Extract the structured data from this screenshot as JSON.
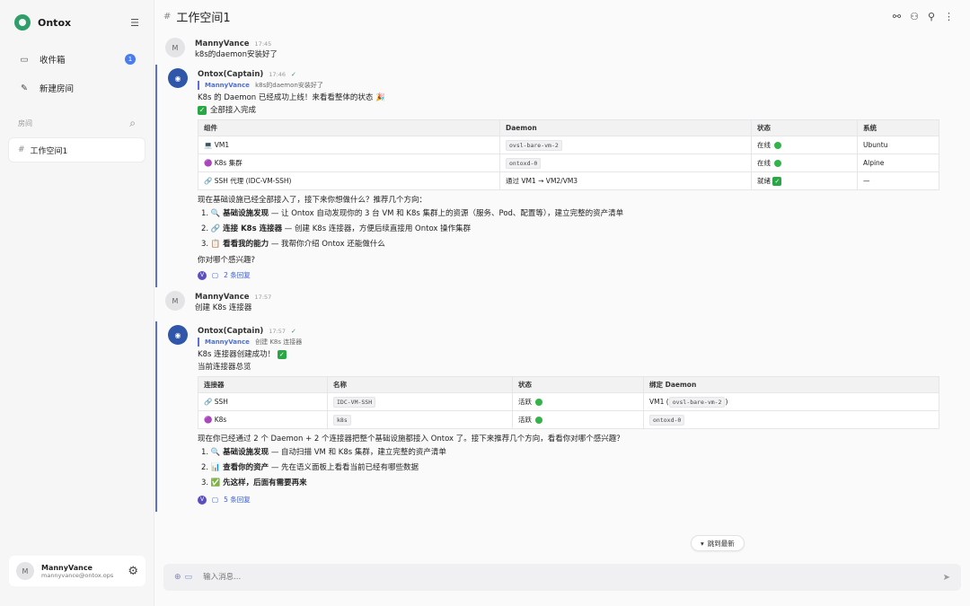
{
  "app": {
    "name": "Ontox"
  },
  "sidebar": {
    "nav": [
      {
        "label": "收件箱",
        "badge": "1"
      },
      {
        "label": "新建房间"
      }
    ],
    "section_label": "房间",
    "rooms": [
      {
        "label": "工作空间1"
      }
    ],
    "user": {
      "initial": "M",
      "name": "MannyVance",
      "email": "mannyvance@ontox.ops..."
    }
  },
  "header": {
    "title": "工作空间1"
  },
  "messages": [
    {
      "author": "MannyVance",
      "time": "17:45",
      "avatar": "M",
      "text": "k8s的daemon安装好了"
    },
    {
      "author": "Ontox(Captain)",
      "time": "17:46",
      "status": "✓",
      "reply_to": {
        "name": "MannyVance",
        "text": "k8s的daemon安装好了"
      },
      "intro": "K8s 的 Daemon 已经成功上线！来看看整体的状态 🎉",
      "all_connected": "全部接入完成",
      "table": {
        "headers": [
          "组件",
          "Daemon",
          "状态",
          "系统"
        ],
        "rows": [
          {
            "c": "💻 VM1",
            "d": "ovsl-bare-vm-2",
            "s": "在线",
            "o": "Ubuntu"
          },
          {
            "c": "🟣 K8s 集群",
            "d": "ontoxd-0",
            "s": "在线",
            "o": "Alpine"
          },
          {
            "c": "🔗 SSH 代理 (IDC-VM-SSH)",
            "d": "通过 VM1 → VM2/VM3",
            "s": "就绪",
            "o": "—"
          }
        ]
      },
      "prompt": "现在基础设施已经全部接入了，接下来你想做什么？推荐几个方向：",
      "options": [
        {
          "n": "1.",
          "icon": "🔍",
          "bold": "基础设施发现",
          "rest": " — 让 Ontox 自动发现你的 3 台 VM 和 K8s 集群上的资源（服务、Pod、配置等），建立完整的资产清单"
        },
        {
          "n": "2.",
          "icon": "🔗",
          "bold": "连接 K8s 连接器",
          "rest": " — 创建 K8s 连接器，方便后续直接用 Ontox 操作集群"
        },
        {
          "n": "3.",
          "icon": "📋",
          "bold": "看看我的能力",
          "rest": " — 我帮你介绍 Ontox 还能做什么"
        }
      ],
      "question": "你对哪个感兴趣?",
      "replies": "2 条回复"
    },
    {
      "author": "MannyVance",
      "time": "17:57",
      "avatar": "M",
      "text": "创建 K8s 连接器"
    },
    {
      "author": "Ontox(Captain)",
      "time": "17:57",
      "status": "✓",
      "reply_to": {
        "name": "MannyVance",
        "text": "创建 K8s 连接器"
      },
      "intro": "K8s 连接器创建成功！",
      "overview": "当前连接器总览",
      "table": {
        "headers": [
          "连接器",
          "名称",
          "状态",
          "绑定 Daemon"
        ],
        "rows": [
          {
            "c": "🔗 SSH",
            "n": "IDC-VM-SSH",
            "s": "活跃",
            "d1": "VM1 (",
            "dc": "ovsl-bare-vm-2",
            "d2": ")"
          },
          {
            "c": "🟣 K8s",
            "n": "k8s",
            "s": "活跃",
            "d1": "",
            "dc": "ontoxd-0",
            "d2": ""
          }
        ]
      },
      "prompt": "现在你已经通过 2 个 Daemon + 2 个连接器把整个基础设施都接入 Ontox 了。接下来推荐几个方向，看看你对哪个感兴趣？",
      "options": [
        {
          "n": "1.",
          "icon": "🔍",
          "bold": "基础设施发现",
          "rest": " — 自动扫描 VM 和 K8s 集群，建立完整的资产清单"
        },
        {
          "n": "2.",
          "icon": "📊",
          "bold": "查看你的资产",
          "rest": " — 先在语义面板上看看当前已经有哪些数据"
        },
        {
          "n": "3.",
          "icon": "✅",
          "bold": "先这样，后面有需要再来",
          "rest": ""
        }
      ],
      "replies": "5 条回复"
    }
  ],
  "jump_label": "跳到最新",
  "composer": {
    "placeholder": "输入消息..."
  }
}
